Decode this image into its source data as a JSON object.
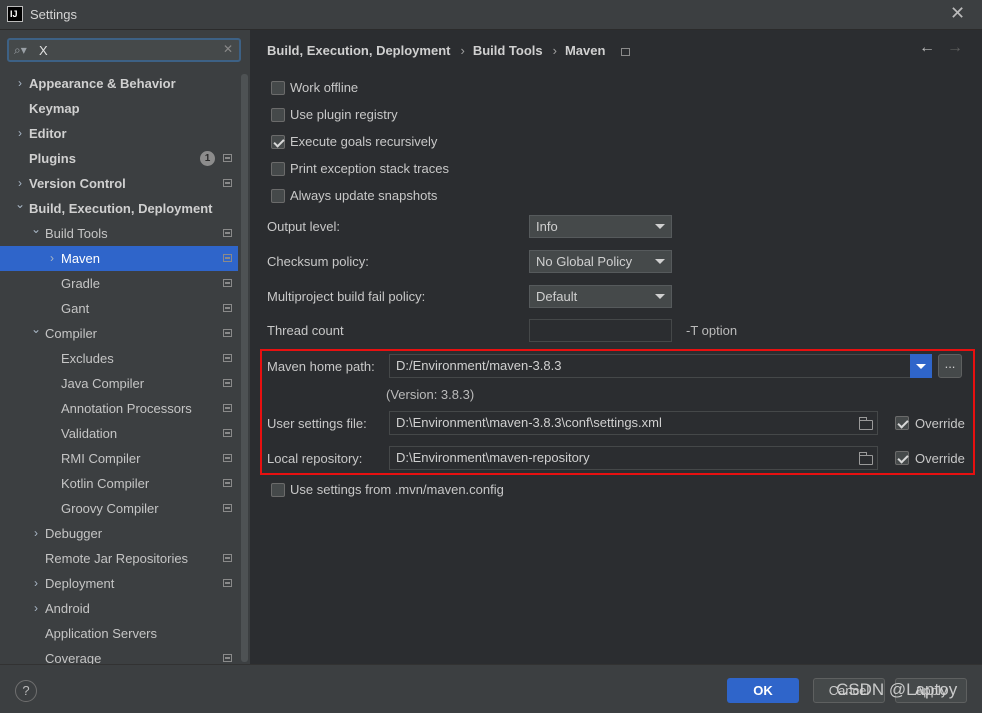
{
  "window": {
    "title": "Settings",
    "app_icon": "IJ"
  },
  "search": {
    "value": "X"
  },
  "tree": [
    {
      "label": "Appearance & Behavior",
      "level": 0,
      "arrow": "right",
      "bold": true
    },
    {
      "label": "Keymap",
      "level": 0,
      "arrow": "",
      "bold": true
    },
    {
      "label": "Editor",
      "level": 0,
      "arrow": "right",
      "bold": true
    },
    {
      "label": "Plugins",
      "level": 0,
      "arrow": "",
      "bold": true,
      "badge": "1",
      "pg": true
    },
    {
      "label": "Version Control",
      "level": 0,
      "arrow": "right",
      "bold": true,
      "pg": true
    },
    {
      "label": "Build, Execution, Deployment",
      "level": 0,
      "arrow": "down",
      "bold": true
    },
    {
      "label": "Build Tools",
      "level": 1,
      "arrow": "down",
      "pg": true
    },
    {
      "label": "Maven",
      "level": 2,
      "arrow": "right",
      "pg": true,
      "selected": true
    },
    {
      "label": "Gradle",
      "level": 2,
      "arrow": "",
      "pg": true
    },
    {
      "label": "Gant",
      "level": 2,
      "arrow": "",
      "pg": true
    },
    {
      "label": "Compiler",
      "level": 1,
      "arrow": "down",
      "pg": true
    },
    {
      "label": "Excludes",
      "level": 2,
      "arrow": "",
      "pg": true
    },
    {
      "label": "Java Compiler",
      "level": 2,
      "arrow": "",
      "pg": true
    },
    {
      "label": "Annotation Processors",
      "level": 2,
      "arrow": "",
      "pg": true
    },
    {
      "label": "Validation",
      "level": 2,
      "arrow": "",
      "pg": true
    },
    {
      "label": "RMI Compiler",
      "level": 2,
      "arrow": "",
      "pg": true
    },
    {
      "label": "Kotlin Compiler",
      "level": 2,
      "arrow": "",
      "pg": true
    },
    {
      "label": "Groovy Compiler",
      "level": 2,
      "arrow": "",
      "pg": true
    },
    {
      "label": "Debugger",
      "level": 1,
      "arrow": "right"
    },
    {
      "label": "Remote Jar Repositories",
      "level": 1,
      "arrow": "",
      "pg": true
    },
    {
      "label": "Deployment",
      "level": 1,
      "arrow": "right",
      "pg": true
    },
    {
      "label": "Android",
      "level": 1,
      "arrow": "right"
    },
    {
      "label": "Application Servers",
      "level": 1,
      "arrow": ""
    },
    {
      "label": "Coverage",
      "level": 1,
      "arrow": "",
      "pg": true
    }
  ],
  "breadcrumb": {
    "part1": "Build, Execution, Deployment",
    "part2": "Build Tools",
    "part3": "Maven"
  },
  "options": {
    "work_offline": "Work offline",
    "use_plugin_registry": "Use plugin registry",
    "execute_goals": "Execute goals recursively",
    "print_exception": "Print exception stack traces",
    "always_update": "Always update snapshots"
  },
  "fields": {
    "output_level_label": "Output level:",
    "output_level_value": "Info",
    "checksum_label": "Checksum policy:",
    "checksum_value": "No Global Policy",
    "multiproject_label": "Multiproject build fail policy:",
    "multiproject_value": "Default",
    "thread_count_label": "Thread count",
    "thread_count_value": "",
    "thread_hint": "-T option",
    "maven_home_label": "Maven home path:",
    "maven_home_value": "D:/Environment/maven-3.8.3",
    "maven_home_browse": "...",
    "version_text": "(Version: 3.8.3)",
    "user_settings_label": "User settings file:",
    "user_settings_value": "D:\\Environment\\maven-3.8.3\\conf\\settings.xml",
    "override_label": "Override",
    "local_repo_label": "Local repository:",
    "local_repo_value": "D:\\Environment\\maven-repository",
    "use_mvn_config": "Use settings from .mvn/maven.config"
  },
  "footer": {
    "ok": "OK",
    "cancel": "Cancel",
    "apply": "Apply",
    "help": "?",
    "watermark": "CSDN @Laptoy"
  },
  "colors": {
    "selection": "#2f65ca",
    "highlight_box": "#e81010"
  }
}
